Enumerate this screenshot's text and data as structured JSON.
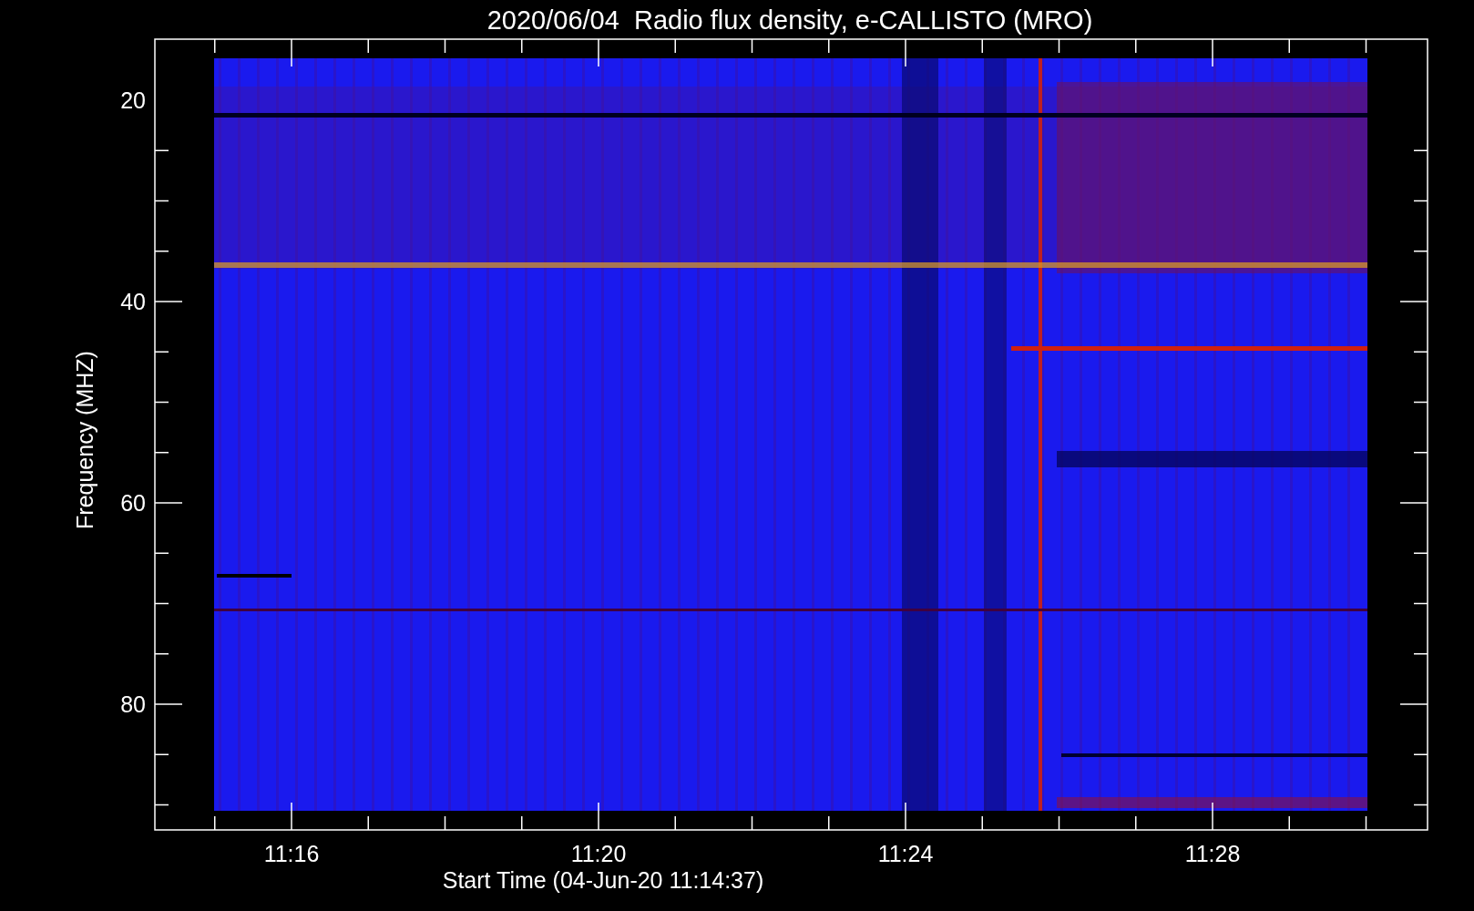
{
  "title": "2020/06/04  Radio flux density, e-CALLISTO (MRO)",
  "y_axis": {
    "label": "Frequency (MHZ)",
    "ticks": [
      "20",
      "40",
      "60",
      "80"
    ]
  },
  "x_axis": {
    "label": "Start Time (04-Jun-20 11:14:37)",
    "ticks": [
      "11:16",
      "11:20",
      "11:24",
      "11:28"
    ]
  }
}
